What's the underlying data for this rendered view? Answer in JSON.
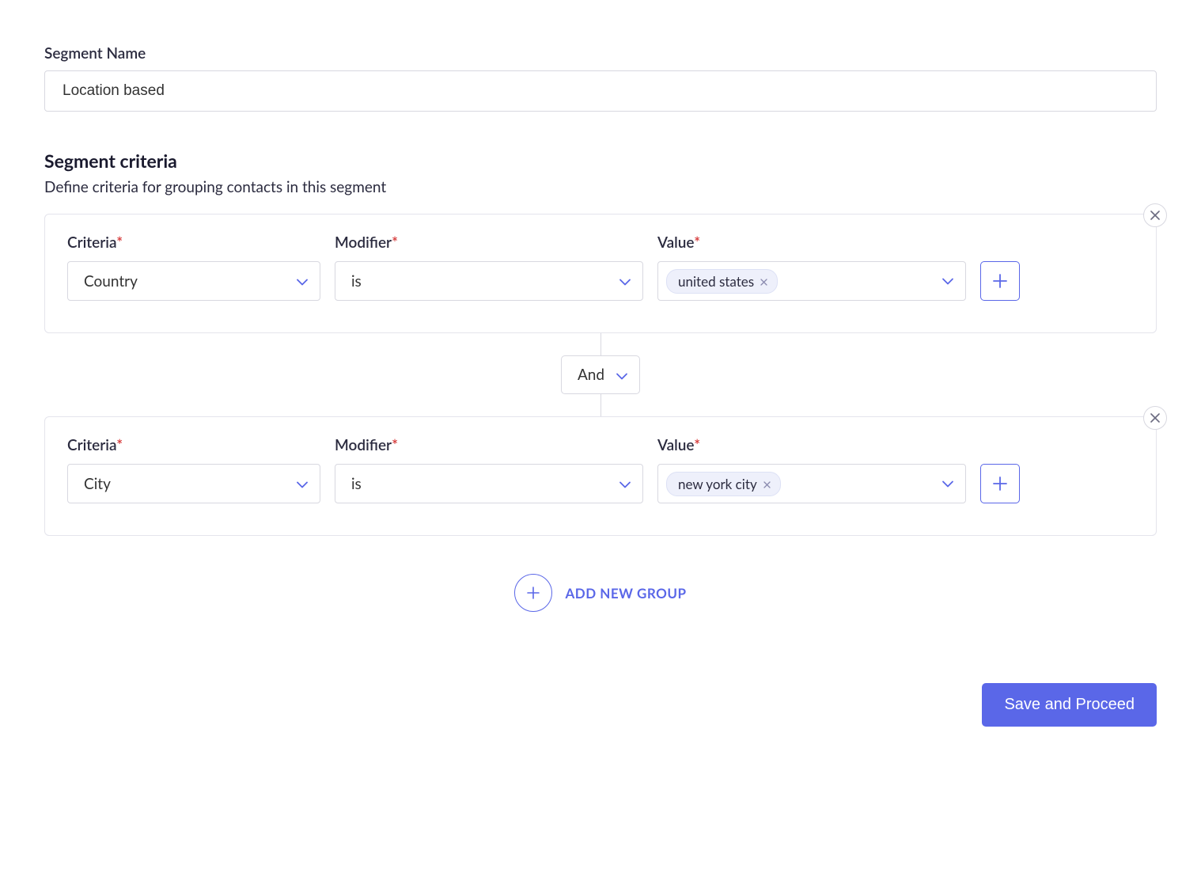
{
  "segmentName": {
    "label": "Segment Name",
    "value": "Location based"
  },
  "criteriaSection": {
    "heading": "Segment criteria",
    "subheading": "Define criteria for grouping contacts in this segment"
  },
  "labels": {
    "criteria": "Criteria",
    "modifier": "Modifier",
    "value": "Value",
    "required": "*"
  },
  "groups": [
    {
      "criteria": "Country",
      "modifier": "is",
      "values": [
        "united states"
      ]
    },
    {
      "criteria": "City",
      "modifier": "is",
      "values": [
        "new york city"
      ]
    }
  ],
  "connector": {
    "value": "And"
  },
  "addGroup": {
    "label": "ADD NEW GROUP"
  },
  "actions": {
    "save": "Save and Proceed"
  },
  "colors": {
    "accent": "#5a67e8",
    "requiredMark": "#d63939"
  }
}
